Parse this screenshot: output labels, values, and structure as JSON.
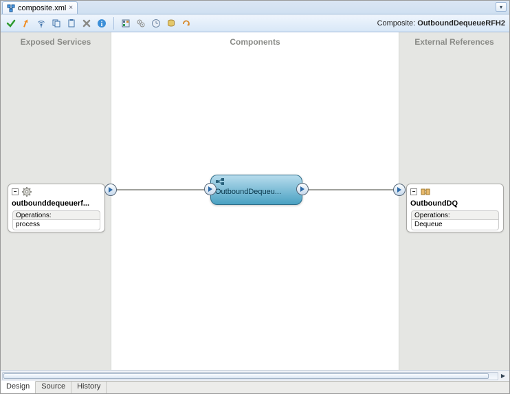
{
  "tab": {
    "title": "composite.xml"
  },
  "toolbar": {
    "icons": [
      "validate-icon",
      "wizard-icon",
      "antenna-icon",
      "copy-icon",
      "paste-icon",
      "delete-icon",
      "info-icon",
      "palette-icon",
      "settings-icon",
      "refresh-icon",
      "db-icon",
      "redo-icon"
    ]
  },
  "composite": {
    "label": "Composite:",
    "name": "OutboundDequeueRFH2"
  },
  "lanes": {
    "left": "Exposed Services",
    "center": "Components",
    "right": "External References"
  },
  "exposed": {
    "name": "outbounddequeuerf...",
    "ops_label": "Operations:",
    "operation": "process"
  },
  "component": {
    "label": "OutboundDequeu..."
  },
  "reference": {
    "name": "OutboundDQ",
    "ops_label": "Operations:",
    "operation": "Dequeue"
  },
  "bottom_tabs": {
    "design": "Design",
    "source": "Source",
    "history": "History"
  }
}
